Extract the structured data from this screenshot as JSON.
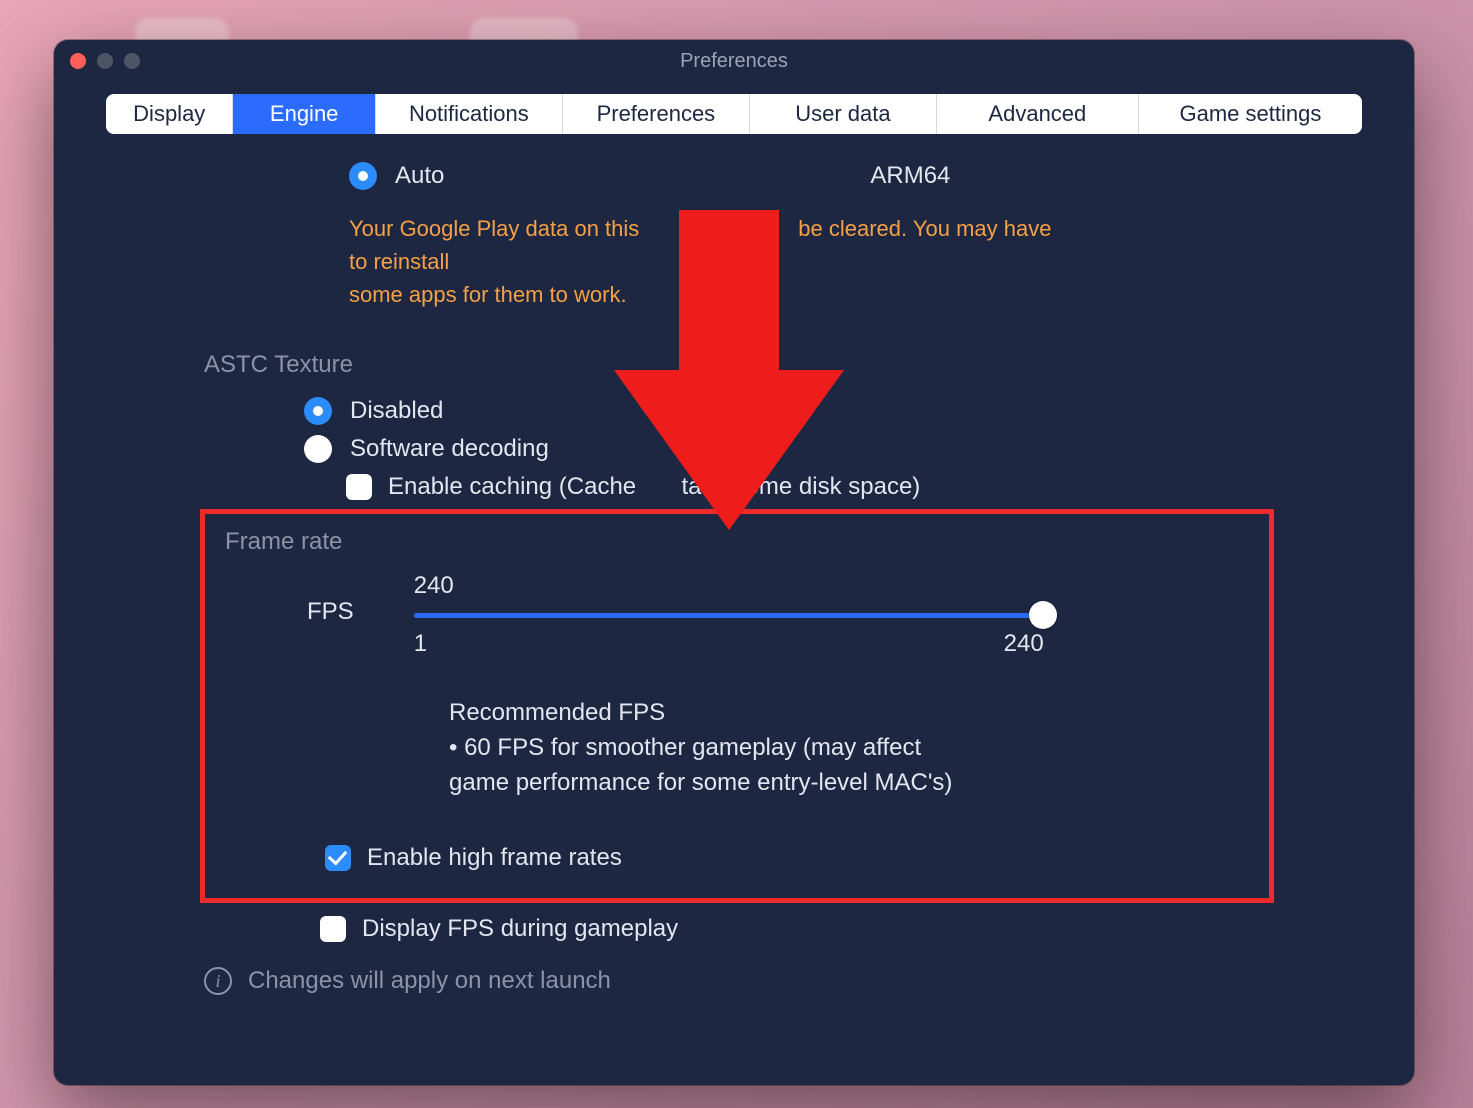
{
  "window": {
    "title": "Preferences"
  },
  "tabs": {
    "display": "Display",
    "engine": "Engine",
    "notifications": "Notifications",
    "preferences": "Preferences",
    "userdata": "User data",
    "advanced": "Advanced",
    "game": "Game settings",
    "active": "engine"
  },
  "arch": {
    "auto": "Auto",
    "arm64": "ARM64",
    "selected": "auto"
  },
  "warning_line1": "Your Google Play data on this ",
  "warning_line1b": "be cleared. You may have to reinstall",
  "warning_line2": "some apps for them to work.",
  "astc": {
    "label": "ASTC Texture",
    "disabled": "Disabled",
    "software": "Software decoding",
    "caching": "Enable caching (Cache",
    "caching_tail": "take some disk space)",
    "selected": "disabled",
    "caching_checked": false
  },
  "frame": {
    "label": "Frame rate",
    "fps_label": "FPS",
    "value": "240",
    "min": "1",
    "max": "240",
    "reco_title": "Recommended FPS",
    "reco_line1": "• 60 FPS for smoother gameplay (may affect",
    "reco_line2": "game performance for some entry-level MAC's)",
    "high_label": "Enable high frame rates",
    "high_checked": true,
    "display_fps_label": "Display FPS during gameplay",
    "display_fps_checked": false
  },
  "note": "Changes will apply on next launch",
  "annotation": {
    "arrow_color": "#ef1c1c",
    "highlight_color": "#ef2a2a"
  }
}
